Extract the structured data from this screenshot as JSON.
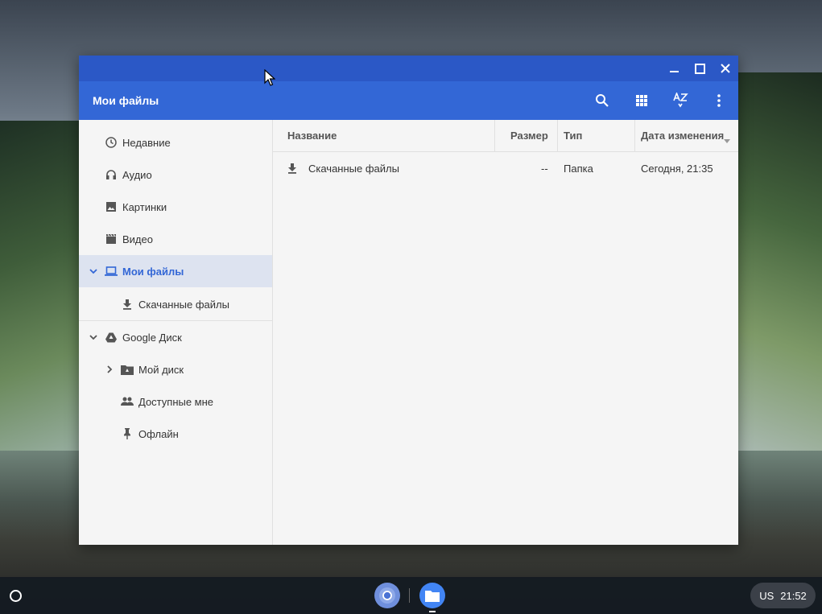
{
  "window": {
    "title": "Мои файлы"
  },
  "toolbar": {
    "search_icon": "search-icon",
    "grid_icon": "grid-view-icon",
    "sort_icon": "sort-az-icon",
    "more_icon": "more-vert-icon"
  },
  "sidebar": {
    "items": [
      {
        "label": "Недавние",
        "icon": "clock-icon"
      },
      {
        "label": "Аудио",
        "icon": "headphones-icon"
      },
      {
        "label": "Картинки",
        "icon": "image-icon"
      },
      {
        "label": "Видео",
        "icon": "video-icon"
      },
      {
        "label": "Мои файлы",
        "icon": "laptop-icon"
      },
      {
        "label": "Скачанные файлы",
        "icon": "download-icon"
      },
      {
        "label": "Google Диск",
        "icon": "drive-icon"
      },
      {
        "label": "Мой диск",
        "icon": "drive-folder-icon"
      },
      {
        "label": "Доступные мне",
        "icon": "people-icon"
      },
      {
        "label": "Офлайн",
        "icon": "pin-icon"
      }
    ]
  },
  "table": {
    "columns": {
      "name": "Название",
      "size": "Размер",
      "type": "Тип",
      "modified": "Дата изменения"
    },
    "rows": [
      {
        "name": "Скачанные файлы",
        "size": "--",
        "type": "Папка",
        "modified": "Сегодня, 21:35"
      }
    ]
  },
  "shelf": {
    "ime": "US",
    "time": "21:52"
  },
  "colors": {
    "titlebar": "#2b58c6",
    "appbar": "#3367d6",
    "accent": "#3367d6"
  }
}
